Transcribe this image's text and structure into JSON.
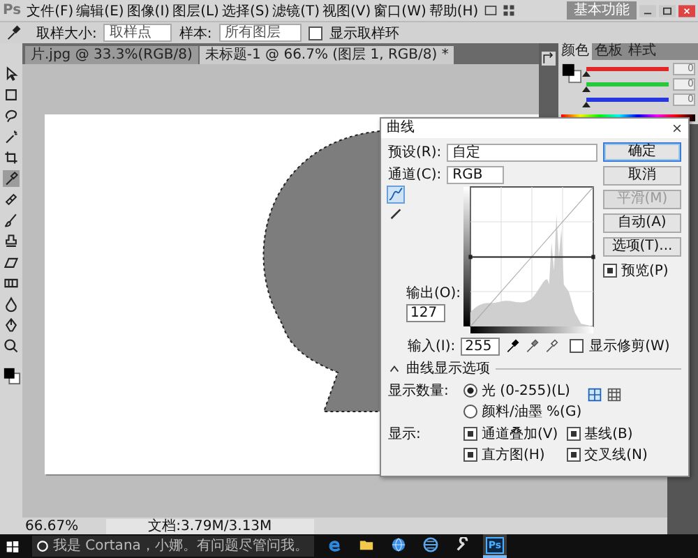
{
  "menu_bar": {
    "logo": "Ps",
    "items": [
      "文件(F)",
      "编辑(E)",
      "图像(I)",
      "图层(L)",
      "选择(S)",
      "滤镜(T)",
      "视图(V)",
      "窗口(W)",
      "帮助(H)"
    ],
    "workspace_button": "基本功能"
  },
  "options_bar": {
    "sample_size_label": "取样大小:",
    "sample_size": "取样点",
    "sample_label": "样本:",
    "sample": "所有图层",
    "show_ring": {
      "label": "显示取样环",
      "checked": false
    }
  },
  "toolbar": {
    "tools": [
      {
        "kind": "move",
        "selected": false
      },
      {
        "kind": "marquee",
        "selected": false
      },
      {
        "kind": "lasso",
        "selected": false
      },
      {
        "kind": "wand",
        "selected": false
      },
      {
        "kind": "crop",
        "selected": false
      },
      {
        "kind": "eyedropper",
        "selected": true
      },
      {
        "kind": "healing",
        "selected": false
      },
      {
        "kind": "brush",
        "selected": false
      },
      {
        "kind": "stamp",
        "selected": false
      },
      {
        "kind": "eraser",
        "selected": false
      },
      {
        "kind": "gradient",
        "selected": false
      },
      {
        "kind": "blur",
        "selected": false
      },
      {
        "kind": "pen",
        "selected": false
      },
      {
        "kind": "zoom",
        "selected": false
      }
    ]
  },
  "document_tabs": [
    {
      "label": "片.jpg @ 33.3%(RGB/8)",
      "selected": false
    },
    {
      "label": "未标题-1 @ 66.7% (图层 1, RGB/8) *",
      "selected": true
    }
  ],
  "color_panel": {
    "tabs": [
      {
        "label": "颜色",
        "selected": true
      },
      {
        "label": "色板",
        "selected": false
      },
      {
        "label": "样式",
        "selected": false
      }
    ],
    "sliders": [
      {
        "color": "#e02828",
        "level": 0,
        "reading": "0"
      },
      {
        "color": "#28c83c",
        "level": 0,
        "reading": "0"
      },
      {
        "color": "#2838e0",
        "level": 0,
        "reading": "0"
      }
    ]
  },
  "curves_dialog": {
    "title": "曲线",
    "preset_label": "预设(R):",
    "preset": "自定",
    "channel_label": "通道(C):",
    "channel": "RGB",
    "buttons": [
      {
        "label": "确定",
        "kind": "default",
        "disabled": false
      },
      {
        "label": "取消",
        "kind": "normal",
        "disabled": false
      },
      {
        "label": "平滑(M)",
        "kind": "normal",
        "disabled": true
      },
      {
        "label": "自动(A)",
        "kind": "normal",
        "disabled": false
      },
      {
        "label": "选项(T)...",
        "kind": "normal",
        "disabled": false
      }
    ],
    "preview": {
      "label": "预览(P)",
      "checked": true
    },
    "output_label": "输出(O):",
    "output": "127",
    "input_label": "输入(I):",
    "input": "255",
    "show_clipping": {
      "label": "显示修剪(W)",
      "checked": false
    },
    "options_title": "曲线显示选项",
    "amount_label": "显示数量:",
    "amount_options": [
      {
        "label": "光 (0-255)(L)",
        "selected": true
      },
      {
        "label": "颜料/油墨 %(G)",
        "selected": false
      }
    ],
    "show_label": "显示:",
    "show_options": [
      {
        "label": "通道叠加(V)",
        "checked": true
      },
      {
        "label": "基线(B)",
        "checked": true
      },
      {
        "label": "直方图(H)",
        "checked": true
      },
      {
        "label": "交叉线(N)",
        "checked": true
      }
    ]
  },
  "status_bar": {
    "zoom": "66.67%",
    "document": "文档:3.79M/3.13M"
  },
  "taskbar": {
    "search_placeholder": "我是 Cortana，小娜。有问题尽管问我。",
    "apps": [
      {
        "kind": "edge",
        "selected": false
      },
      {
        "kind": "folder",
        "selected": false
      },
      {
        "kind": "globe",
        "selected": false
      },
      {
        "kind": "network",
        "selected": false
      },
      {
        "kind": "tools",
        "selected": false
      },
      {
        "kind": "photoshop",
        "label": "Ps",
        "selected": true
      }
    ]
  }
}
